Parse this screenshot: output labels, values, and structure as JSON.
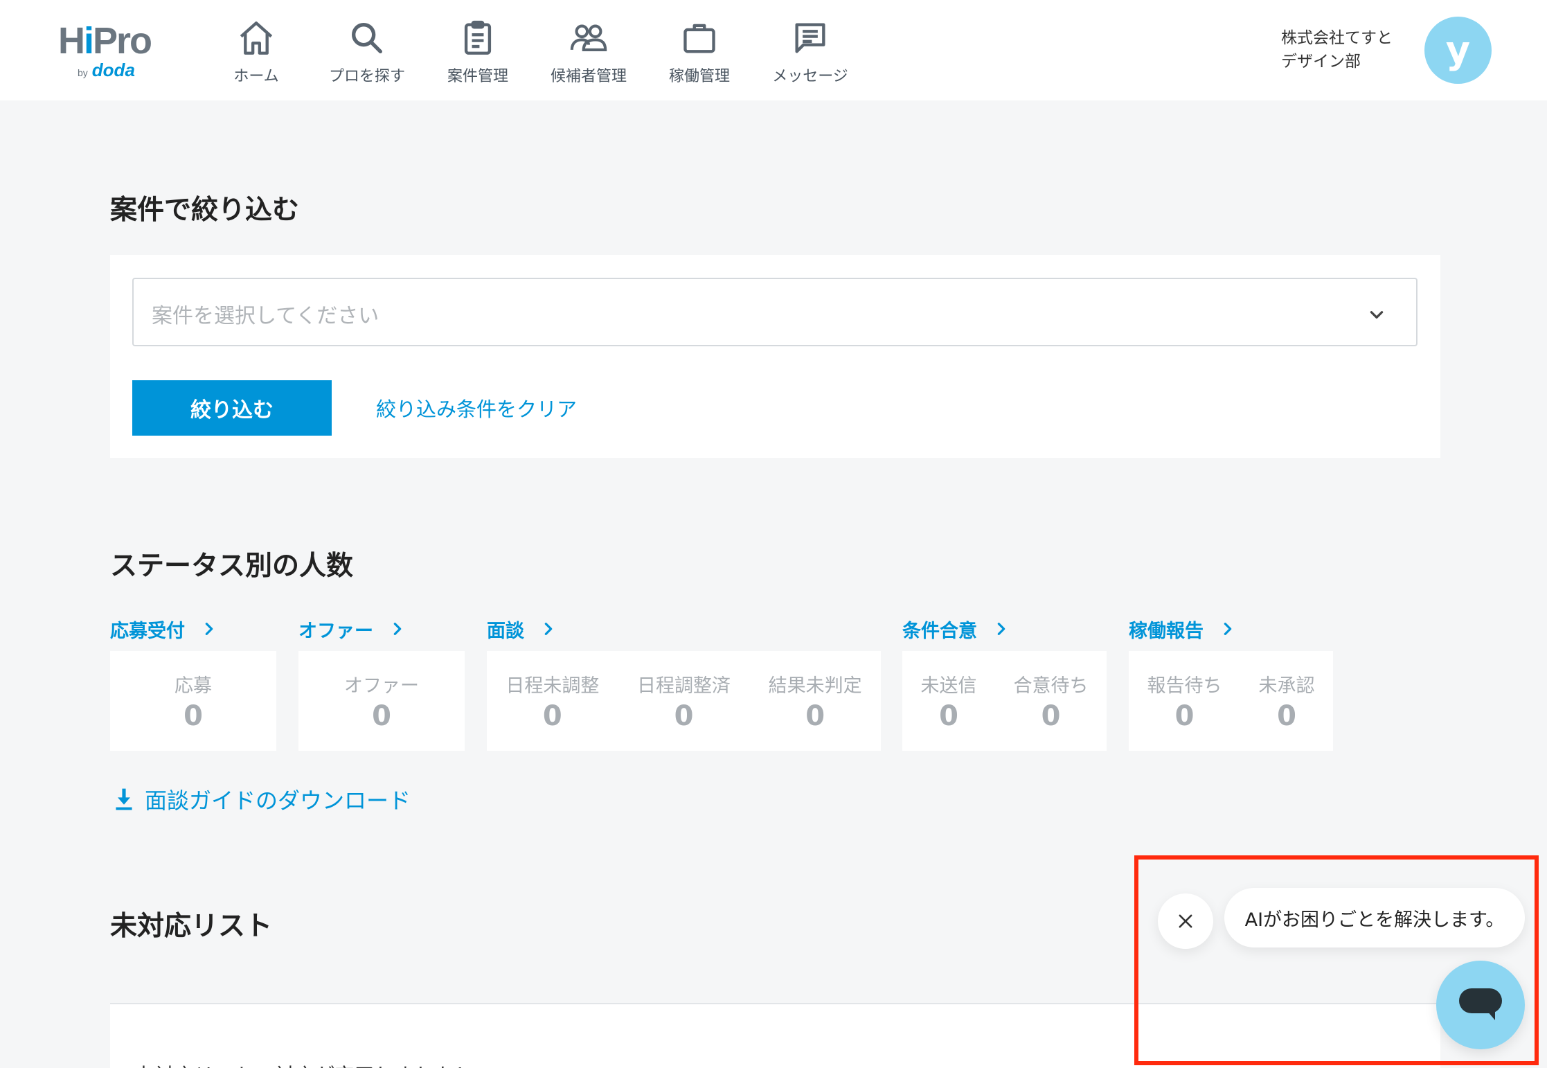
{
  "brand": {
    "logo_main_a": "H",
    "logo_main_i": "i",
    "logo_main_b": "Pro",
    "logo_by": "by",
    "logo_sub": "doda"
  },
  "nav": [
    {
      "label": "ホーム",
      "icon": "home-icon"
    },
    {
      "label": "プロを探す",
      "icon": "search-icon"
    },
    {
      "label": "案件管理",
      "icon": "clipboard-icon"
    },
    {
      "label": "候補者管理",
      "icon": "users-icon"
    },
    {
      "label": "稼働管理",
      "icon": "briefcase-icon"
    },
    {
      "label": "メッセージ",
      "icon": "message-icon"
    }
  ],
  "user": {
    "company": "株式会社てすと",
    "department": "デザイン部",
    "avatar_initial": "y"
  },
  "filter": {
    "title": "案件で絞り込む",
    "select_placeholder": "案件を選択してください",
    "submit_label": "絞り込む",
    "clear_label": "絞り込み条件をクリア"
  },
  "status": {
    "title": "ステータス別の人数",
    "groups": [
      {
        "label": "応募受付",
        "items": [
          {
            "label": "応募",
            "value": "0"
          }
        ]
      },
      {
        "label": "オファー",
        "items": [
          {
            "label": "オファー",
            "value": "0"
          }
        ]
      },
      {
        "label": "面談",
        "items": [
          {
            "label": "日程未調整",
            "value": "0"
          },
          {
            "label": "日程調整済",
            "value": "0"
          },
          {
            "label": "結果未判定",
            "value": "0"
          }
        ]
      },
      {
        "label": "条件合意",
        "items": [
          {
            "label": "未送信",
            "value": "0"
          },
          {
            "label": "合意待ち",
            "value": "0"
          }
        ]
      },
      {
        "label": "稼働報告",
        "items": [
          {
            "label": "報告待ち",
            "value": "0"
          },
          {
            "label": "未承認",
            "value": "0"
          }
        ]
      }
    ],
    "download_label": "面談ガイドのダウンロード"
  },
  "pending": {
    "title": "未対応リスト",
    "message": "未対応リストの対応が完了しました！"
  },
  "ai_widget": {
    "bubble_text": "AIがお困りごとを解決します。"
  },
  "colors": {
    "accent": "#0094d8",
    "avatar": "#8dd6f2",
    "highlight": "#ff2a0e",
    "background": "#f5f6f7"
  }
}
